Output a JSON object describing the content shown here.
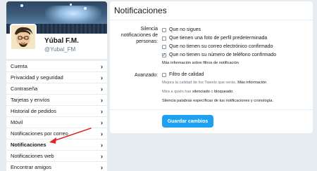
{
  "profile": {
    "name": "Yúbal F.M.",
    "handle": "@Yubal_FM"
  },
  "sidebar": {
    "items": [
      {
        "label": "Cuenta"
      },
      {
        "label": "Privacidad y seguridad"
      },
      {
        "label": "Contraseña"
      },
      {
        "label": "Tarjetas y envíos"
      },
      {
        "label": "Historial de pedidos"
      },
      {
        "label": "Móvil"
      },
      {
        "label": "Notificaciones por correo"
      },
      {
        "label": "Notificaciones"
      },
      {
        "label": "Notificaciones web"
      },
      {
        "label": "Encontrar amigos"
      }
    ],
    "active_index": 7
  },
  "panel": {
    "title": "Notificaciones",
    "mute_label": "Silencia notificaciones de personas:",
    "mute_options": [
      {
        "label": "Que no sigues",
        "checked": false
      },
      {
        "label": "Que tienen una foto de perfil predeterminada",
        "checked": false
      },
      {
        "label": "Que no tienen su correo electrónico confirmado",
        "checked": false
      },
      {
        "label": "Que no tienen su número de teléfono confirmado",
        "checked": true
      }
    ],
    "more_info": "Más información sobre filtros de notificación",
    "advanced_label": "Avanzado:",
    "quality_filter": {
      "label": "Filtro de calidad",
      "checked": false
    },
    "quality_note_a": "Mejora la calidad de los Tweets que verás.",
    "quality_note_b": "Más información",
    "muted_note_a": "Mira a quién has",
    "muted_note_b": "silenciado",
    "muted_note_c": "o",
    "muted_note_d": "bloqueado",
    "muted_note_e": ".",
    "words_note": "Silencia palabras específicas de tus notificaciones y cronología.",
    "save_button": "Guardar cambios"
  },
  "colors": {
    "accent": "#1da1f2",
    "background": "#e6ecf0",
    "annotation_arrow": "#e0242b"
  }
}
